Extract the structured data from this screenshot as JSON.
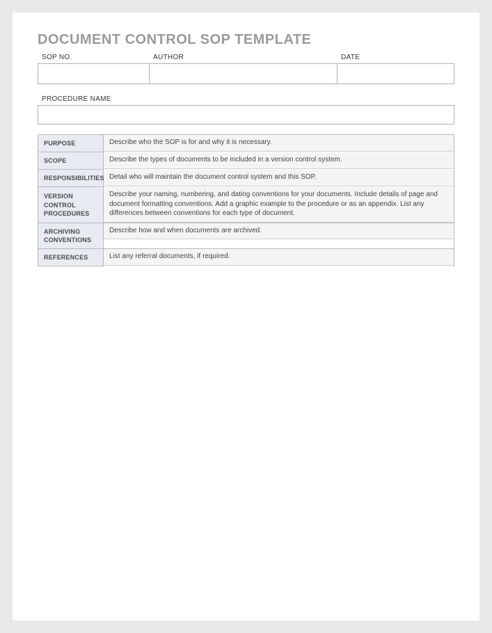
{
  "title": "DOCUMENT CONTROL SOP TEMPLATE",
  "meta": {
    "sop_no_label": "SOP NO.",
    "sop_no_value": "",
    "author_label": "AUTHOR",
    "author_value": "",
    "date_label": "DATE",
    "date_value": ""
  },
  "procedure": {
    "label": "PROCEDURE NAME",
    "value": ""
  },
  "sections": [
    {
      "key": "purpose",
      "label": "PURPOSE",
      "desc": "Describe who the SOP is for and why it is necessary.",
      "content": "",
      "hclass": "h-purpose"
    },
    {
      "key": "scope",
      "label": "SCOPE",
      "desc": "Describe the types of documents to be included in a version control system.",
      "content": "",
      "hclass": "h-scope"
    },
    {
      "key": "responsibilities",
      "label": "RESPONSIBILITIES",
      "desc": "Detail who will maintain the document control system and this SOP.",
      "content": "",
      "hclass": "h-resp"
    },
    {
      "key": "version_control_procedures",
      "label": "VERSION CONTROL PROCEDURES",
      "desc": "Describe your naming, numbering, and dating conventions for your documents. Include details of page and document formatting conventions.  Add a graphic example to the procedure or as an appendix. List any differences between conventions for each type of document.",
      "content": "",
      "hclass": "h-vcp"
    },
    {
      "key": "archiving_conventions",
      "label": "ARCHIVING CONVENTIONS",
      "desc": "Describe how and when documents are archived.",
      "content": "",
      "hclass": "h-arch"
    },
    {
      "key": "references",
      "label": "REFERENCES",
      "desc": "List any referral documents, if required.",
      "content": "",
      "hclass": "h-ref"
    }
  ]
}
